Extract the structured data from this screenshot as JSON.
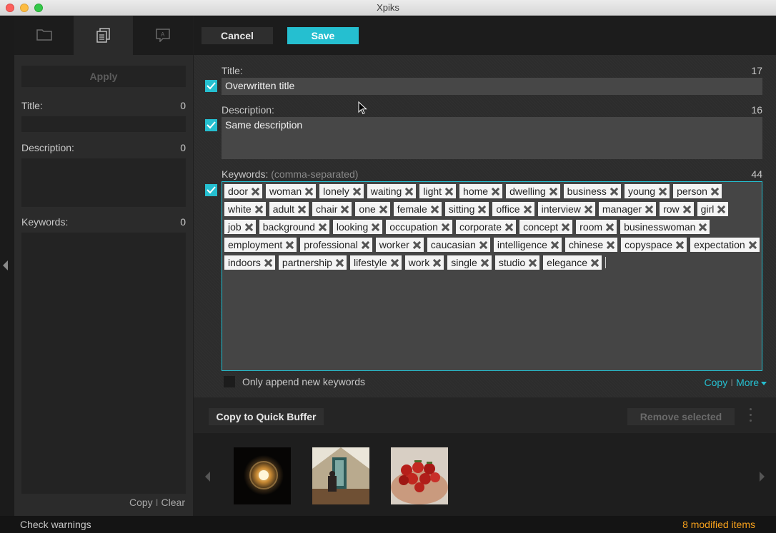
{
  "window": {
    "title": "Xpiks"
  },
  "left_panel": {
    "tabs": [
      {
        "icon": "folder-icon"
      },
      {
        "icon": "combined-edit-icon",
        "active": true
      },
      {
        "icon": "quick-buffer-icon"
      }
    ],
    "apply_label": "Apply",
    "title_label": "Title:",
    "title_count": "0",
    "description_label": "Description:",
    "description_count": "0",
    "keywords_label": "Keywords:",
    "keywords_count": "0",
    "copy_label": "Copy",
    "separator": "I",
    "clear_label": "Clear"
  },
  "toolbar": {
    "cancel_label": "Cancel",
    "save_label": "Save"
  },
  "form": {
    "title": {
      "label": "Title:",
      "count": "17",
      "value": "Overwritten title",
      "checked": true
    },
    "description": {
      "label": "Description:",
      "count": "16",
      "value": "Same description",
      "checked": true
    },
    "keywords": {
      "label": "Keywords:",
      "hint": "(comma-separated)",
      "count": "44",
      "checked": true,
      "items": [
        "door",
        "woman",
        "lonely",
        "waiting",
        "light",
        "home",
        "dwelling",
        "business",
        "young",
        "person",
        "white",
        "adult",
        "chair",
        "one",
        "female",
        "sitting",
        "office",
        "interview",
        "manager",
        "row",
        "girl",
        "job",
        "background",
        "looking",
        "occupation",
        "corporate",
        "concept",
        "room",
        "businesswoman",
        "employment",
        "professional",
        "worker",
        "caucasian",
        "intelligence",
        "chinese",
        "copyspace",
        "expectation",
        "indoors",
        "partnership",
        "lifestyle",
        "work",
        "single",
        "studio",
        "elegance"
      ]
    },
    "append_label": "Only append new keywords",
    "copy_label": "Copy",
    "separator": "I",
    "more_label": "More"
  },
  "actions": {
    "copy_quick_buffer_label": "Copy to Quick Buffer",
    "remove_selected_label": "Remove selected"
  },
  "status": {
    "check_warnings_label": "Check warnings",
    "modified_label": "8 modified items"
  },
  "colors": {
    "accent": "#25bfd0",
    "warning": "#f7a11c"
  }
}
